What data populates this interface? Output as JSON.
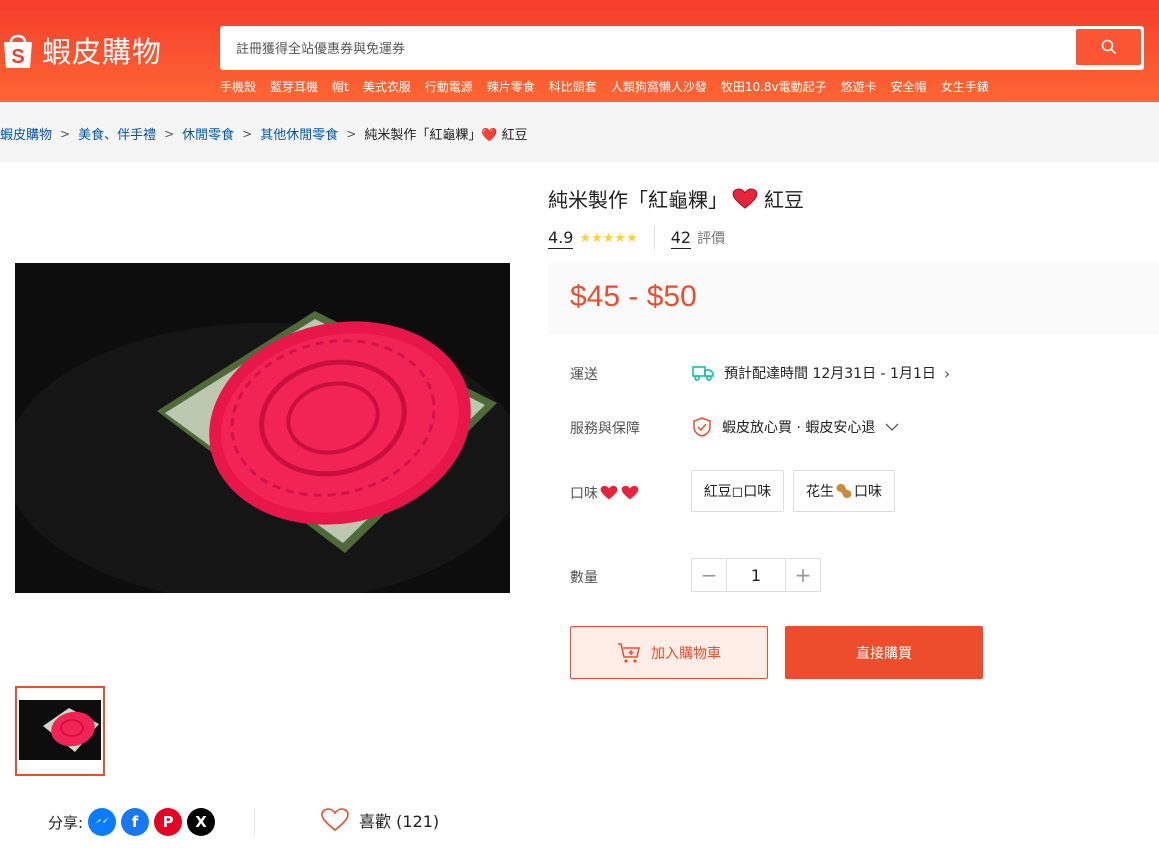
{
  "header": {
    "brand": "蝦皮購物",
    "search_placeholder": "註冊獲得全站優惠券與免運券",
    "hotwords": [
      "手機殼",
      "藍芽耳機",
      "帽t",
      "美式衣服",
      "行動電源",
      "辣片零食",
      "科比頭套",
      "人類狗窩懶人沙發",
      "牧田10.8v電動起子",
      "悠遊卡",
      "安全帽",
      "女生手錶"
    ]
  },
  "breadcrumb": {
    "items": [
      "蝦皮購物",
      "美食、伴手禮",
      "休閒零食",
      "其他休閒零食"
    ],
    "current": "純米製作「紅龜粿」❤️ 紅豆"
  },
  "product": {
    "title": "純米製作「紅龜粿」",
    "title_suffix": "紅豆",
    "rating": "4.9",
    "stars": "★★★★★",
    "review_count": "42",
    "review_label": "評價",
    "price": "$45 - $50",
    "shipping_label": "運送",
    "shipping_value": "預計配達時間 12月31日 - 1月1日",
    "service_label": "服務與保障",
    "service_value": "蝦皮放心買 · 蝦皮安心退",
    "flavor_label": "口味",
    "flavor_options": [
      "紅豆◻︎口味",
      "花生",
      "口味"
    ],
    "quantity_label": "數量",
    "quantity_value": "1",
    "add_to_cart": "加入購物車",
    "buy_now": "直接購買"
  },
  "social": {
    "share_label": "分享:",
    "like_label": "喜歡 (121)"
  },
  "colors": {
    "brand": "#ee4d2d",
    "header": "#f53d2d",
    "star": "#ffce3d",
    "link": "#0055aa"
  }
}
